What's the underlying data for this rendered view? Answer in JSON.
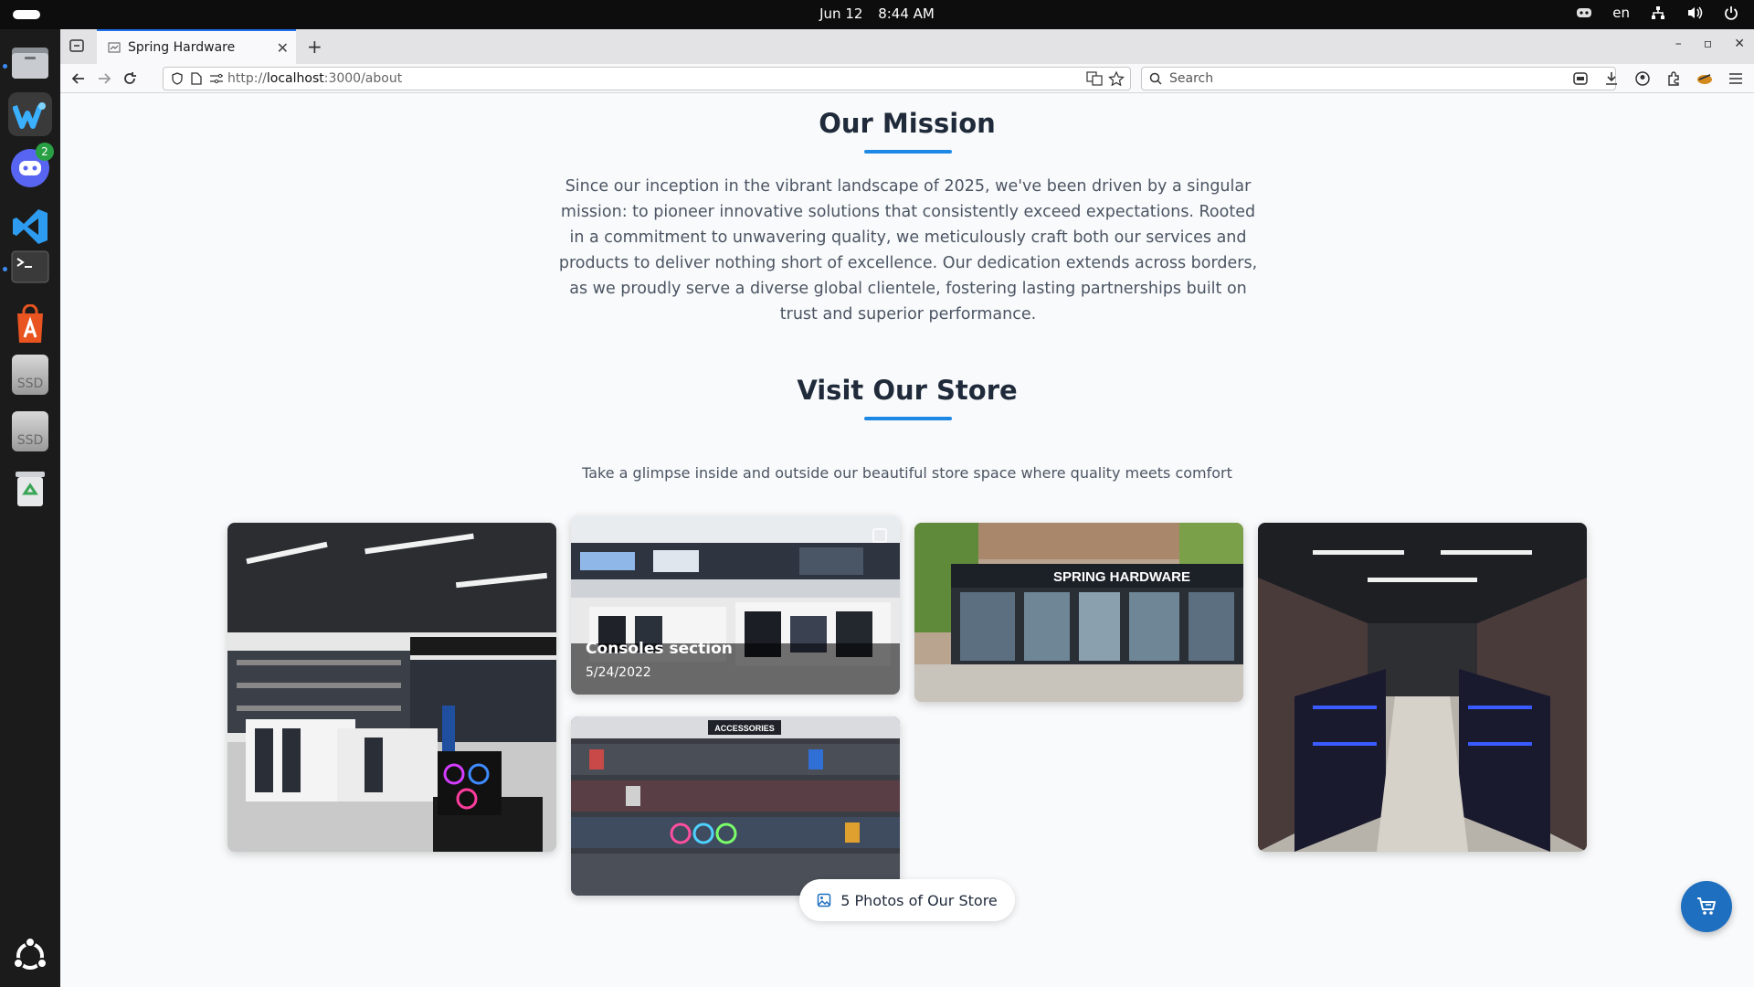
{
  "system": {
    "date": "Jun 12",
    "time": "8:44 AM",
    "language": "en"
  },
  "dock": {
    "discord_badge": "2",
    "ssd1_label": "SSD",
    "ssd2_label": "SSD"
  },
  "browser": {
    "tab_title": "Spring Hardware",
    "url_prefix": "http://",
    "url_host": "localhost",
    "url_path": ":3000/about",
    "search_placeholder": "Search"
  },
  "mission": {
    "title": "Our Mission",
    "text": "Since our inception in the vibrant landscape of 2025, we've been driven by a singular mission: to pioneer innovative solutions that consistently exceed expectations. Rooted in a commitment to unwavering quality, we meticulously craft both our services and products to deliver nothing short of excellence. Our dedication extends across borders, as we proudly serve a diverse global clientele, fostering lasting partnerships built on trust and superior performance."
  },
  "store": {
    "title": "Visit Our Store",
    "subtitle": "Take a glimpse inside and outside our beautiful store space where quality meets comfort",
    "photos": [
      {
        "name": "store-photo-interior-left"
      },
      {
        "name": "store-photo-consoles",
        "caption": "Consoles section",
        "date": "5/24/2022"
      },
      {
        "name": "store-photo-exterior",
        "sign": "SPRING HARDWARE"
      },
      {
        "name": "store-photo-aisle"
      },
      {
        "name": "store-photo-accessories",
        "sign": "ACCESSORIES"
      }
    ],
    "photos_button": "5 Photos of Our Store"
  },
  "colors": {
    "accent": "#1e88e5",
    "heading": "#1f2a3a",
    "body_text": "#4b5563",
    "cart_button": "#1e6fbf"
  }
}
